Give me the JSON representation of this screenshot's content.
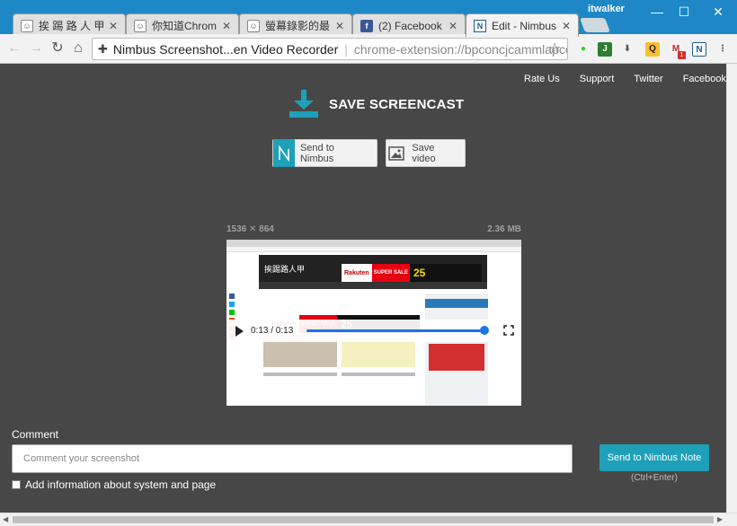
{
  "browser": {
    "tabs": [
      {
        "title": "挨 踢 路 人 甲 - h",
        "favicon": "person-icon",
        "active": false
      },
      {
        "title": "你知道Chrome",
        "favicon": "person-icon",
        "active": false
      },
      {
        "title": "螢幕錄影的最佳",
        "favicon": "person-icon",
        "active": false
      },
      {
        "title": "(2) Facebook",
        "favicon": "facebook-icon",
        "active": false
      },
      {
        "title": "Edit - Nimbus Sc",
        "favicon": "nimbus-icon",
        "active": true
      }
    ],
    "user": "itwalker",
    "address_ext_name": "Nimbus Screenshot...en Video Recorder",
    "address_url": "chrome-extension://bpconcjcammlapcogc..."
  },
  "top_links": [
    "Rate Us",
    "Support",
    "Twitter",
    "Facebook"
  ],
  "heading": "SAVE SCREENCAST",
  "buttons": {
    "send_nimbus": "Send to Nimbus",
    "save_video": "Save video",
    "send_note": "Send to Nimbus Note",
    "send_hint": "(Ctrl+Enter)"
  },
  "video": {
    "dimensions": "1536 ✕ 864",
    "size": "2.36 MB",
    "time": "0:13 / 0:13",
    "progress": 1.0,
    "preview_site_title": "挨踢路人甲",
    "banner_brand": "Rakuten",
    "banner_sale": "SUPER SALE",
    "banner_discount": "25"
  },
  "comment": {
    "label": "Comment",
    "placeholder": "Comment your screenshot",
    "add_info_label": "Add information about system and page"
  },
  "colors": {
    "page_bg": "#474747",
    "accent": "#1ea0b8",
    "tabstrip": "#1e88c7"
  }
}
